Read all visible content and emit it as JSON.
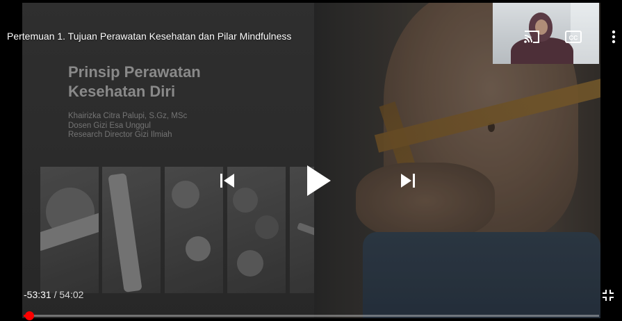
{
  "video": {
    "title": "Pertemuan 1. Tujuan Perawatan Kesehatan dan Pilar Mindfulness"
  },
  "slide": {
    "title": "Prinsip Perawatan\nKesehatan Diri",
    "lines": [
      "Khairizka Citra Palupi, S.Gz, MSc",
      "Dosen Gizi Esa Unggul",
      "Research Director Gizi Ilmiah"
    ]
  },
  "controls": {
    "icons": {
      "cast": "cast-icon",
      "cc": "closed-captions-icon",
      "menu": "more-vert-icon",
      "prev": "skip-previous-icon",
      "play": "play-icon",
      "next": "skip-next-icon",
      "exit_fullscreen": "exit-fullscreen-icon"
    },
    "cc_label": "CC"
  },
  "time": {
    "remaining": "-53:31",
    "separator": " / ",
    "duration": "54:02"
  },
  "progress": {
    "fraction": 0.01,
    "color": "#ff0000"
  }
}
